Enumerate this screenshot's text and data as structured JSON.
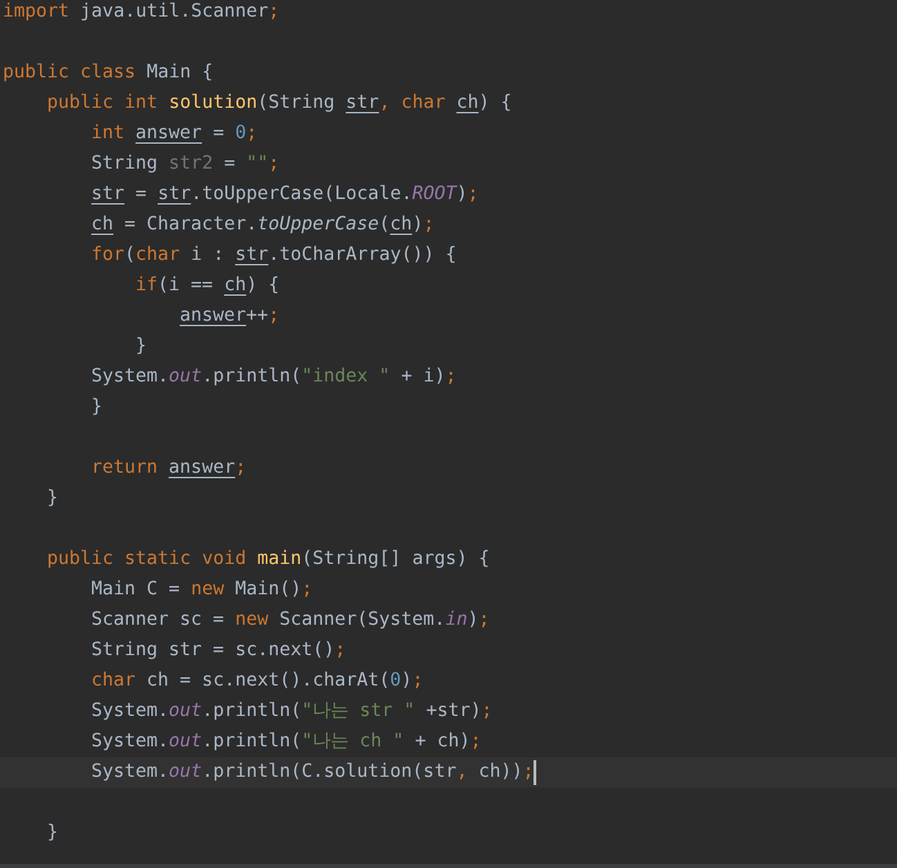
{
  "editor": {
    "lines": [
      {
        "kind": "code",
        "current": false,
        "tokens": [
          {
            "text": "import ",
            "kind": "keyword"
          },
          {
            "text": "java.util.Scanner",
            "kind": "plain"
          },
          {
            "text": ";",
            "kind": "punct"
          }
        ]
      },
      {
        "kind": "blank"
      },
      {
        "kind": "code",
        "current": false,
        "tokens": [
          {
            "text": "public class ",
            "kind": "keyword"
          },
          {
            "text": "Main {",
            "kind": "plain"
          }
        ],
        "children": [
          {
            "kind": "code",
            "current": false,
            "tokens": [
              {
                "text": "public int ",
                "kind": "keyword"
              },
              {
                "text": "solution",
                "kind": "decl"
              },
              {
                "text": "(String ",
                "kind": "plain"
              },
              {
                "text": "str",
                "kind": "var"
              },
              {
                "text": ", ",
                "kind": "punct"
              },
              {
                "text": "char ",
                "kind": "keyword"
              },
              {
                "text": "ch",
                "kind": "var"
              },
              {
                "text": ") {",
                "kind": "plain"
              }
            ],
            "children": [
              {
                "kind": "code",
                "current": false,
                "tokens": [
                  {
                    "text": "int ",
                    "kind": "keyword"
                  },
                  {
                    "text": "answer",
                    "kind": "var"
                  },
                  {
                    "text": " = ",
                    "kind": "plain"
                  },
                  {
                    "text": "0",
                    "kind": "number"
                  },
                  {
                    "text": ";",
                    "kind": "punct"
                  }
                ]
              },
              {
                "kind": "code",
                "current": false,
                "tokens": [
                  {
                    "text": "String ",
                    "kind": "plain"
                  },
                  {
                    "text": "str2",
                    "kind": "unused"
                  },
                  {
                    "text": " = ",
                    "kind": "plain"
                  },
                  {
                    "text": "\"\"",
                    "kind": "string"
                  },
                  {
                    "text": ";",
                    "kind": "punct"
                  }
                ]
              },
              {
                "kind": "code",
                "current": false,
                "tokens": [
                  {
                    "text": "str",
                    "kind": "var"
                  },
                  {
                    "text": " = ",
                    "kind": "plain"
                  },
                  {
                    "text": "str",
                    "kind": "var"
                  },
                  {
                    "text": ".toUpperCase(Locale.",
                    "kind": "plain"
                  },
                  {
                    "text": "ROOT",
                    "kind": "field"
                  },
                  {
                    "text": ")",
                    "kind": "plain"
                  },
                  {
                    "text": ";",
                    "kind": "punct"
                  }
                ]
              },
              {
                "kind": "code",
                "current": false,
                "tokens": [
                  {
                    "text": "ch",
                    "kind": "var"
                  },
                  {
                    "text": " = Character.",
                    "kind": "plain"
                  },
                  {
                    "text": "toUpperCase",
                    "kind": "static"
                  },
                  {
                    "text": "(",
                    "kind": "plain"
                  },
                  {
                    "text": "ch",
                    "kind": "var"
                  },
                  {
                    "text": ")",
                    "kind": "plain"
                  },
                  {
                    "text": ";",
                    "kind": "punct"
                  }
                ]
              },
              {
                "kind": "code",
                "current": false,
                "tokens": [
                  {
                    "text": "for",
                    "kind": "keyword"
                  },
                  {
                    "text": "(",
                    "kind": "plain"
                  },
                  {
                    "text": "char ",
                    "kind": "keyword"
                  },
                  {
                    "text": "i : ",
                    "kind": "plain"
                  },
                  {
                    "text": "str",
                    "kind": "var"
                  },
                  {
                    "text": ".toCharArray()) {",
                    "kind": "plain"
                  }
                ],
                "children": [
                  {
                    "kind": "code",
                    "current": false,
                    "tokens": [
                      {
                        "text": "if",
                        "kind": "keyword"
                      },
                      {
                        "text": "(i == ",
                        "kind": "plain"
                      },
                      {
                        "text": "ch",
                        "kind": "var"
                      },
                      {
                        "text": ") {",
                        "kind": "plain"
                      }
                    ],
                    "children": [
                      {
                        "kind": "code",
                        "current": false,
                        "tokens": [
                          {
                            "text": "answer",
                            "kind": "var"
                          },
                          {
                            "text": "++",
                            "kind": "plain"
                          },
                          {
                            "text": ";",
                            "kind": "punct"
                          }
                        ]
                      }
                    ]
                  },
                  {
                    "kind": "code",
                    "current": false,
                    "tokens": [
                      {
                        "text": "}",
                        "kind": "plain"
                      }
                    ]
                  }
                ]
              },
              {
                "kind": "code",
                "current": false,
                "tokens": [
                  {
                    "text": "System.",
                    "kind": "plain"
                  },
                  {
                    "text": "out",
                    "kind": "field"
                  },
                  {
                    "text": ".println(",
                    "kind": "plain"
                  },
                  {
                    "text": "\"index \"",
                    "kind": "string"
                  },
                  {
                    "text": " + i)",
                    "kind": "plain"
                  },
                  {
                    "text": ";",
                    "kind": "punct"
                  }
                ]
              },
              {
                "kind": "code",
                "current": false,
                "tokens": [
                  {
                    "text": "}",
                    "kind": "plain"
                  }
                ]
              },
              {
                "kind": "blank"
              },
              {
                "kind": "code",
                "current": false,
                "tokens": [
                  {
                    "text": "return ",
                    "kind": "keyword"
                  },
                  {
                    "text": "answer",
                    "kind": "var"
                  },
                  {
                    "text": ";",
                    "kind": "punct"
                  }
                ]
              }
            ]
          },
          {
            "kind": "code",
            "current": false,
            "tokens": [
              {
                "text": "}",
                "kind": "plain"
              }
            ]
          },
          {
            "kind": "blank"
          },
          {
            "kind": "code",
            "current": false,
            "tokens": [
              {
                "text": "public static void ",
                "kind": "keyword"
              },
              {
                "text": "main",
                "kind": "decl"
              },
              {
                "text": "(String[] args) {",
                "kind": "plain"
              }
            ],
            "children": [
              {
                "kind": "code",
                "current": false,
                "tokens": [
                  {
                    "text": "Main C = ",
                    "kind": "plain"
                  },
                  {
                    "text": "new ",
                    "kind": "keyword"
                  },
                  {
                    "text": "Main()",
                    "kind": "plain"
                  },
                  {
                    "text": ";",
                    "kind": "punct"
                  }
                ]
              },
              {
                "kind": "code",
                "current": false,
                "tokens": [
                  {
                    "text": "Scanner sc = ",
                    "kind": "plain"
                  },
                  {
                    "text": "new ",
                    "kind": "keyword"
                  },
                  {
                    "text": "Scanner(System.",
                    "kind": "plain"
                  },
                  {
                    "text": "in",
                    "kind": "field"
                  },
                  {
                    "text": ")",
                    "kind": "plain"
                  },
                  {
                    "text": ";",
                    "kind": "punct"
                  }
                ]
              },
              {
                "kind": "code",
                "current": false,
                "tokens": [
                  {
                    "text": "String str = sc.next()",
                    "kind": "plain"
                  },
                  {
                    "text": ";",
                    "kind": "punct"
                  }
                ]
              },
              {
                "kind": "code",
                "current": false,
                "tokens": [
                  {
                    "text": "char ",
                    "kind": "keyword"
                  },
                  {
                    "text": "ch = sc.next().charAt(",
                    "kind": "plain"
                  },
                  {
                    "text": "0",
                    "kind": "number"
                  },
                  {
                    "text": ")",
                    "kind": "plain"
                  },
                  {
                    "text": ";",
                    "kind": "punct"
                  }
                ]
              },
              {
                "kind": "code",
                "current": false,
                "tokens": [
                  {
                    "text": "System.",
                    "kind": "plain"
                  },
                  {
                    "text": "out",
                    "kind": "field"
                  },
                  {
                    "text": ".println(",
                    "kind": "plain"
                  },
                  {
                    "text": "\"나는 str \"",
                    "kind": "string"
                  },
                  {
                    "text": " +str)",
                    "kind": "plain"
                  },
                  {
                    "text": ";",
                    "kind": "punct"
                  }
                ]
              },
              {
                "kind": "code",
                "current": false,
                "tokens": [
                  {
                    "text": "System.",
                    "kind": "plain"
                  },
                  {
                    "text": "out",
                    "kind": "field"
                  },
                  {
                    "text": ".println(",
                    "kind": "plain"
                  },
                  {
                    "text": "\"나는 ch \"",
                    "kind": "string"
                  },
                  {
                    "text": " + ch)",
                    "kind": "plain"
                  },
                  {
                    "text": ";",
                    "kind": "punct"
                  }
                ]
              },
              {
                "kind": "code",
                "current": true,
                "tokens": [
                  {
                    "text": "System.",
                    "kind": "plain"
                  },
                  {
                    "text": "out",
                    "kind": "field"
                  },
                  {
                    "text": ".println(C.solution(str",
                    "kind": "plain"
                  },
                  {
                    "text": ", ",
                    "kind": "punct"
                  },
                  {
                    "text": "ch))",
                    "kind": "plain"
                  },
                  {
                    "text": ";",
                    "kind": "punct"
                  }
                ]
              },
              {
                "kind": "blank"
              }
            ]
          },
          {
            "kind": "code",
            "current": false,
            "tokens": [
              {
                "text": "}",
                "kind": "plain"
              }
            ]
          }
        ]
      }
    ]
  }
}
